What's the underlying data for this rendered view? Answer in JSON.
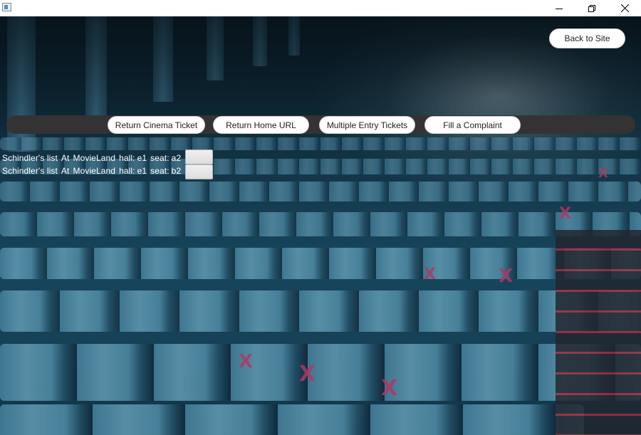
{
  "window": {
    "title": "",
    "controls": [
      "minimize-icon",
      "restore-icon",
      "close-icon"
    ]
  },
  "header": {
    "back_label": "Back to Site"
  },
  "nav": {
    "buttons": [
      {
        "label": "Return Cinema Ticket"
      },
      {
        "label": "Return Home URL"
      },
      {
        "label": "Multiple Entry Tickets"
      },
      {
        "label": "Fill a Complaint"
      }
    ]
  },
  "tickets": [
    {
      "movie": "Schindler's list",
      "at_label": "At",
      "cinema": "MovieLand",
      "hall_label": "hall:",
      "hall": "e1",
      "seat_label": "seat:",
      "seat": "a2"
    },
    {
      "movie": "Schindler's list",
      "at_label": "At",
      "cinema": "MovieLand",
      "hall_label": "hall:",
      "hall": "e1",
      "seat_label": "seat:",
      "seat": "b2"
    }
  ],
  "colors": {
    "nav_bar": "#333333",
    "button_bg": "#ffffff",
    "text_on_bg": "#ffffff",
    "seat_logo": "#d6457a"
  }
}
